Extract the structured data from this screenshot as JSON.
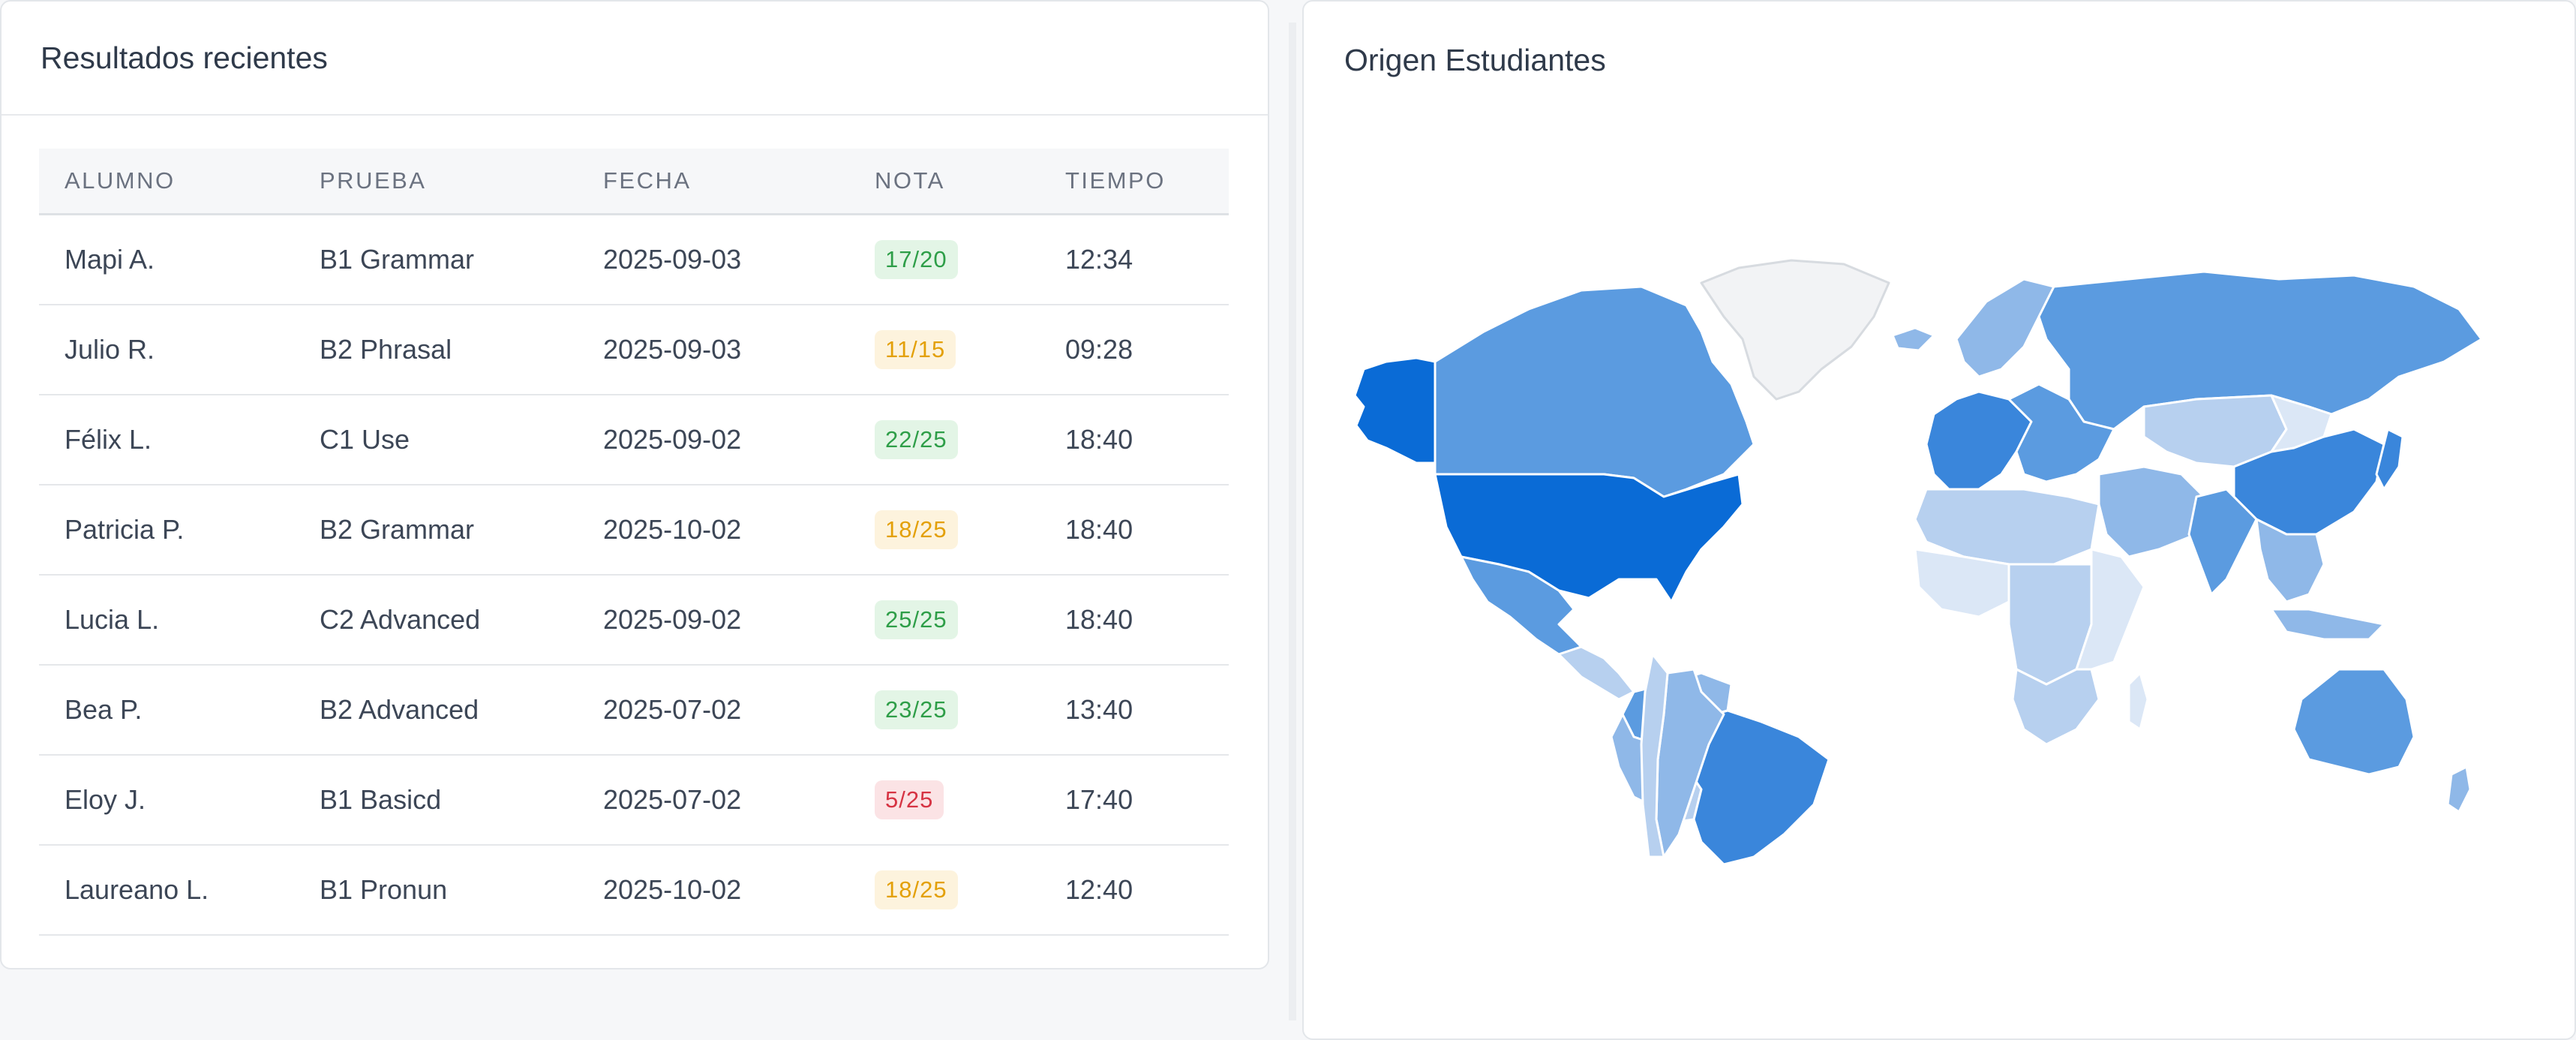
{
  "results_card": {
    "title": "Resultados recientes",
    "columns": [
      "ALUMNO",
      "PRUEBA",
      "FECHA",
      "NOTA",
      "TIEMPO"
    ],
    "rows": [
      {
        "alumno": "Mapi A.",
        "prueba": "B1 Grammar",
        "fecha": "2025-09-03",
        "nota": "17/20",
        "status": "success",
        "tiempo": "12:34"
      },
      {
        "alumno": "Julio R.",
        "prueba": "B2 Phrasal",
        "fecha": "2025-09-03",
        "nota": "11/15",
        "status": "warning",
        "tiempo": "09:28"
      },
      {
        "alumno": "Félix L.",
        "prueba": "C1 Use",
        "fecha": "2025-09-02",
        "nota": "22/25",
        "status": "success",
        "tiempo": "18:40"
      },
      {
        "alumno": "Patricia P.",
        "prueba": "B2 Grammar",
        "fecha": "2025-10-02",
        "nota": "18/25",
        "status": "warning",
        "tiempo": "18:40"
      },
      {
        "alumno": "Lucia L.",
        "prueba": "C2 Advanced",
        "fecha": "2025-09-02",
        "nota": "25/25",
        "status": "success",
        "tiempo": "18:40"
      },
      {
        "alumno": "Bea P.",
        "prueba": "B2 Advanced",
        "fecha": "2025-07-02",
        "nota": "23/25",
        "status": "success",
        "tiempo": "13:40"
      },
      {
        "alumno": "Eloy J.",
        "prueba": "B1 Basicd",
        "fecha": "2025-07-02",
        "nota": "5/25",
        "status": "danger",
        "tiempo": "17:40"
      },
      {
        "alumno": "Laureano L.",
        "prueba": "B1 Pronun",
        "fecha": "2025-10-02",
        "nota": "18/25",
        "status": "warning",
        "tiempo": "12:40"
      }
    ]
  },
  "badge_colors": {
    "success": {
      "bg": "#e3f5e6",
      "fg": "#2e9e48"
    },
    "warning": {
      "bg": "#fdf3dd",
      "fg": "#e3a008"
    },
    "danger": {
      "bg": "#fbe3e5",
      "fg": "#d63343"
    }
  },
  "map_card": {
    "title": "Origen Estudiantes",
    "legend": "none",
    "scale_colors": [
      "#dbe7f6",
      "#b7d0ef",
      "#8fb8e8",
      "#5b9be0",
      "#3a86db",
      "#0a6bd6"
    ],
    "no_data_color": "#f2f3f5",
    "regions": [
      {
        "name": "Alaska (US)",
        "level": 5
      },
      {
        "name": "Canada",
        "level": 3
      },
      {
        "name": "Greenland",
        "level": -1
      },
      {
        "name": "United States",
        "level": 5
      },
      {
        "name": "Mexico",
        "level": 3
      },
      {
        "name": "Central America",
        "level": 1
      },
      {
        "name": "Colombia",
        "level": 3
      },
      {
        "name": "Venezuela",
        "level": 2
      },
      {
        "name": "Peru",
        "level": 2
      },
      {
        "name": "Bolivia",
        "level": 1
      },
      {
        "name": "Brazil",
        "level": 4
      },
      {
        "name": "Argentina",
        "level": 2
      },
      {
        "name": "Chile",
        "level": 1
      },
      {
        "name": "Iceland",
        "level": 2
      },
      {
        "name": "Scandinavia",
        "level": 2
      },
      {
        "name": "Russia",
        "level": 3
      },
      {
        "name": "Western Europe",
        "level": 4
      },
      {
        "name": "Eastern Europe",
        "level": 3
      },
      {
        "name": "North Africa",
        "level": 1
      },
      {
        "name": "West Africa",
        "level": 0
      },
      {
        "name": "Central Africa",
        "level": 1
      },
      {
        "name": "East Africa",
        "level": 0
      },
      {
        "name": "Southern Africa",
        "level": 1
      },
      {
        "name": "Madagascar",
        "level": 0
      },
      {
        "name": "Middle East",
        "level": 2
      },
      {
        "name": "Central Asia",
        "level": 1
      },
      {
        "name": "Mongolia",
        "level": 0
      },
      {
        "name": "China",
        "level": 4
      },
      {
        "name": "India",
        "level": 3
      },
      {
        "name": "Southeast Asia",
        "level": 2
      },
      {
        "name": "Japan",
        "level": 4
      },
      {
        "name": "Indonesia",
        "level": 2
      },
      {
        "name": "Australia",
        "level": 3
      },
      {
        "name": "New Zealand",
        "level": 2
      }
    ]
  }
}
